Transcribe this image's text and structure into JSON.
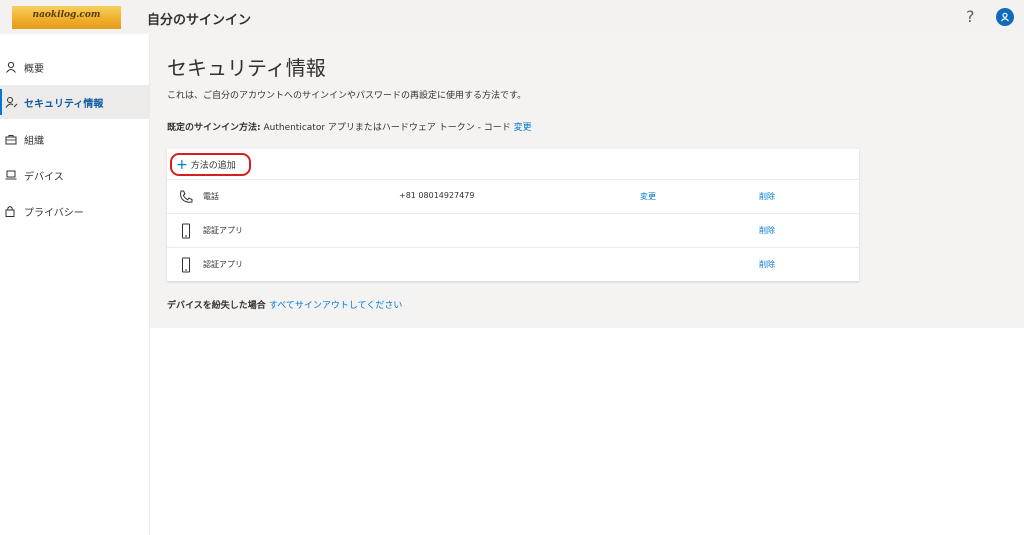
{
  "header": {
    "logo_text": "naokilog.com",
    "title": "自分のサインイン",
    "help_symbol": "?"
  },
  "sidebar": {
    "items": [
      {
        "label": "概要",
        "icon": "person-icon",
        "active": false
      },
      {
        "label": "セキュリティ情報",
        "icon": "security-info-icon",
        "active": true
      },
      {
        "label": "組織",
        "icon": "briefcase-icon",
        "active": false
      },
      {
        "label": "デバイス",
        "icon": "laptop-icon",
        "active": false
      },
      {
        "label": "プライバシー",
        "icon": "lock-icon",
        "active": false
      }
    ]
  },
  "main": {
    "title": "セキュリティ情報",
    "description": "これは、ご自分のアカウントへのサインインやパスワードの再設定に使用する方法です。",
    "default_label": "既定のサインイン方法:",
    "default_value": " Authenticator アプリまたはハードウェア トークン - コード ",
    "default_change": "変更",
    "add_method": {
      "plus": "+",
      "label": "方法の追加"
    },
    "methods": [
      {
        "icon": "phone-icon",
        "name": "電話",
        "value": "+81 08014927479",
        "change": "変更",
        "delete": "削除"
      },
      {
        "icon": "mobile-device-icon",
        "name": "認証アプリ",
        "value": "",
        "change": "",
        "delete": "削除"
      },
      {
        "icon": "mobile-device-icon",
        "name": "認証アプリ",
        "value": "",
        "change": "",
        "delete": "削除"
      }
    ],
    "lost_label": "デバイスを紛失した場合 ",
    "lost_link": "すべてサインアウトしてください"
  },
  "colors": {
    "accent": "#0078d4",
    "highlight_ring": "#d61f1f",
    "header_bg": "#f3f2f1",
    "logo_gold": "#efb02d"
  }
}
